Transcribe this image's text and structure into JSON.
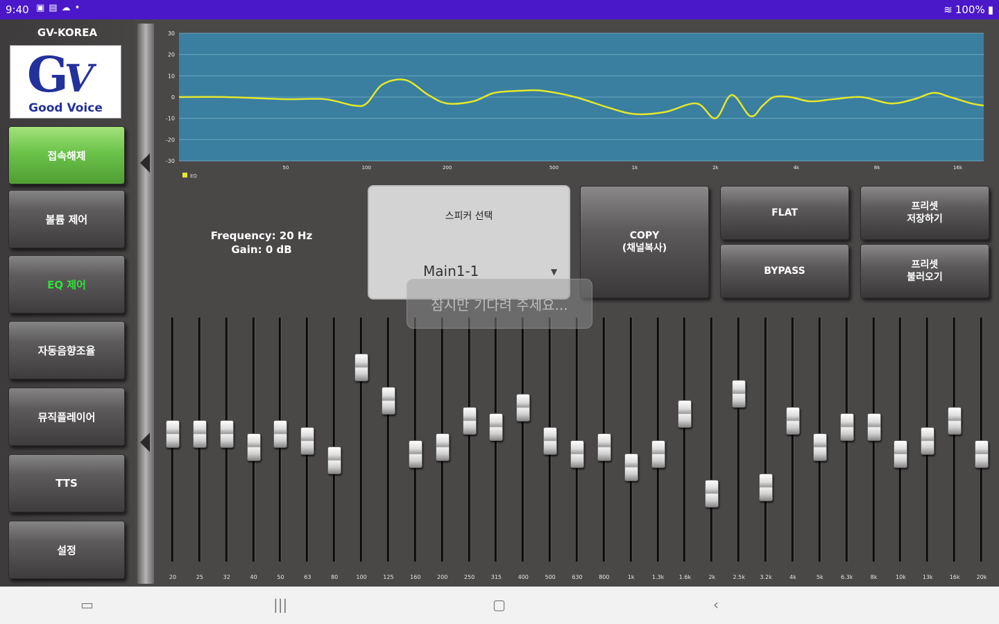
{
  "status_bar": {
    "time": "9:40",
    "notification_icons": [
      "image-icon",
      "message-icon",
      "cloud-icon",
      "dot-icon"
    ],
    "battery": "100%"
  },
  "sidebar": {
    "brand": "GV-KOREA",
    "logo_tagline": "Good Voice",
    "items": [
      {
        "label": "접속해제",
        "state": "active"
      },
      {
        "label": "볼륨 제어",
        "state": "normal"
      },
      {
        "label": "EQ 제어",
        "state": "selected"
      },
      {
        "label": "자동음향조율",
        "state": "normal"
      },
      {
        "label": "뮤직플레이어",
        "state": "normal"
      },
      {
        "label": "TTS",
        "state": "normal"
      },
      {
        "label": "설정",
        "state": "normal"
      }
    ]
  },
  "info": {
    "frequency": "Frequency: 20 Hz",
    "gain": "Gain: 0 dB"
  },
  "speaker": {
    "title": "스피커 선택",
    "selected": "Main1-1"
  },
  "buttons": {
    "copy": "COPY\n(채널복사)",
    "flat": "FLAT",
    "bypass": "BYPASS",
    "preset_save": "프리셋\n저장하기",
    "preset_load": "프리셋\n불러오기"
  },
  "toast": "잠시만 기다려 주세요...",
  "chart_data": {
    "type": "line",
    "title": "",
    "xlabel": "",
    "ylabel": "",
    "xscale": "log",
    "ylim": [
      -30,
      30
    ],
    "yticks": [
      "30",
      "20",
      "10",
      "0",
      "-10",
      "-20",
      "-30"
    ],
    "xticks": [
      "50",
      "100",
      "200",
      "500",
      "1k",
      "2k",
      "4k",
      "8k",
      "16k"
    ],
    "legend": "bottom-left",
    "legend_text": "EQ",
    "line_color": "#e5e82a",
    "background_color": "#3a7f9f",
    "series": [
      {
        "x": [
          20,
          30,
          50,
          70,
          90,
          100,
          115,
          140,
          170,
          200,
          250,
          300,
          380,
          450,
          600,
          800,
          1000,
          1300,
          1700,
          2000,
          2300,
          2700,
          3000,
          3300,
          3800,
          4500,
          5500,
          7000,
          9000,
          11000,
          13000,
          15000,
          18000,
          20000
        ],
        "y": [
          0,
          0,
          -1,
          -1,
          -4,
          -3,
          6,
          8,
          1,
          -3,
          -2,
          2,
          3,
          3,
          0,
          -5,
          -8,
          -7,
          -3,
          -10,
          1,
          -9,
          -4,
          0,
          0,
          -2,
          -1,
          0,
          -3,
          -1,
          2,
          0,
          -3,
          -4
        ]
      }
    ]
  },
  "eq": {
    "bands": [
      "20",
      "25",
      "32",
      "40",
      "50",
      "63",
      "80",
      "100",
      "125",
      "160",
      "200",
      "250",
      "315",
      "400",
      "500",
      "630",
      "800",
      "1k",
      "1.3k",
      "1.6k",
      "2k",
      "2.5k",
      "3.2k",
      "4k",
      "5k",
      "6.3k",
      "8k",
      "10k",
      "13k",
      "16k",
      "20k"
    ],
    "gains": [
      0,
      0,
      0,
      -2,
      0,
      -1,
      -4,
      10,
      5,
      -3,
      -2,
      2,
      1,
      4,
      -1,
      -3,
      -2,
      -5,
      -3,
      3,
      -9,
      6,
      -8,
      2,
      -2,
      1,
      1,
      -3,
      -1,
      2,
      -3
    ],
    "gain_range": [
      -15,
      15
    ]
  }
}
